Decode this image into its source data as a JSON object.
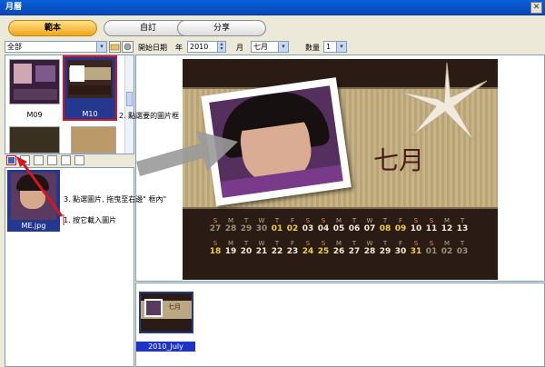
{
  "window": {
    "title": "月曆",
    "close": "✕"
  },
  "tabs": [
    {
      "label": "範本",
      "active": true
    },
    {
      "label": "自訂",
      "active": false
    },
    {
      "label": "分享",
      "active": false
    }
  ],
  "left": {
    "category": "全部",
    "templates": [
      {
        "label": "M09"
      },
      {
        "label": "M10",
        "selected": true
      }
    ],
    "photo": {
      "label": "ME.jpg"
    }
  },
  "options": {
    "start_date_label": "開始日期",
    "year_label": "年",
    "year_value": "2010",
    "month_label": "月",
    "month_value": "七月",
    "qty_label": "數量",
    "qty_value": "1"
  },
  "calendar": {
    "month_title": "七月",
    "days_header": [
      "S",
      "M",
      "T",
      "W",
      "T",
      "F",
      "S",
      "S",
      "M",
      "T",
      "W",
      "T",
      "F",
      "S",
      "S",
      "M",
      "T"
    ],
    "row1": [
      "27",
      "28",
      "29",
      "30",
      "01",
      "02",
      "03",
      "04",
      "05",
      "06",
      "07",
      "08",
      "09",
      "10",
      "11",
      "12",
      "13"
    ],
    "row2": [
      "18",
      "19",
      "20",
      "21",
      "22",
      "23",
      "24",
      "25",
      "26",
      "27",
      "28",
      "29",
      "30",
      "31",
      "01",
      "02",
      "03"
    ],
    "row1_weekend_idx": [
      4,
      5,
      11,
      12
    ],
    "row2_weekend_idx": [
      0,
      6,
      7,
      13
    ],
    "colors": {
      "background": "#2b1b15",
      "band": "#c9b58a",
      "weekend": "#f0d040",
      "header_weekend": "#e58c4a",
      "header": "#bda77f"
    }
  },
  "preview": {
    "label": "2010_July"
  },
  "annotations": {
    "step1": "1. 按它載入圖片",
    "step2": "2. 點選要的圖片框",
    "step3": "3. 點選圖片, 拖曳至右邊\" 框內\""
  }
}
